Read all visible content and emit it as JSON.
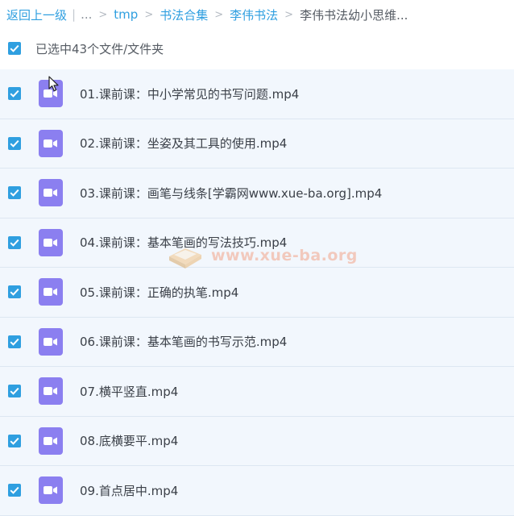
{
  "breadcrumb": {
    "back_label": "返回上一级",
    "ellipsis": "...",
    "items": [
      {
        "label": "tmp"
      },
      {
        "label": "书法合集"
      },
      {
        "label": "李伟书法"
      }
    ],
    "current": "李伟书法幼小思维..."
  },
  "selection": {
    "text": "已选中43个文件/文件夹",
    "checked": true
  },
  "files": [
    {
      "name": "01.课前课：中小学常见的书写问题.mp4",
      "type": "video",
      "checked": true
    },
    {
      "name": "02.课前课：坐姿及其工具的使用.mp4",
      "type": "video",
      "checked": true
    },
    {
      "name": "03.课前课：画笔与线条[学霸网www.xue-ba.org].mp4",
      "type": "video",
      "checked": true
    },
    {
      "name": "04.课前课：基本笔画的写法技巧.mp4",
      "type": "video",
      "checked": true
    },
    {
      "name": "05.课前课：正确的执笔.mp4",
      "type": "video",
      "checked": true
    },
    {
      "name": "06.课前课：基本笔画的书写示范.mp4",
      "type": "video",
      "checked": true
    },
    {
      "name": "07.横平竖直.mp4",
      "type": "video",
      "checked": true
    },
    {
      "name": "08.底横要平.mp4",
      "type": "video",
      "checked": true
    },
    {
      "name": "09.首点居中.mp4",
      "type": "video",
      "checked": true
    }
  ],
  "watermark": {
    "text": "www.xue-ba.org"
  },
  "colors": {
    "accent": "#2f9fe0",
    "row_bg": "#f2f7fd",
    "video_icon": "#8b7ff0"
  },
  "icons": {
    "checkbox": "check-icon",
    "file": "video-file-icon",
    "breadcrumb_separator": "chevron-right-icon"
  }
}
